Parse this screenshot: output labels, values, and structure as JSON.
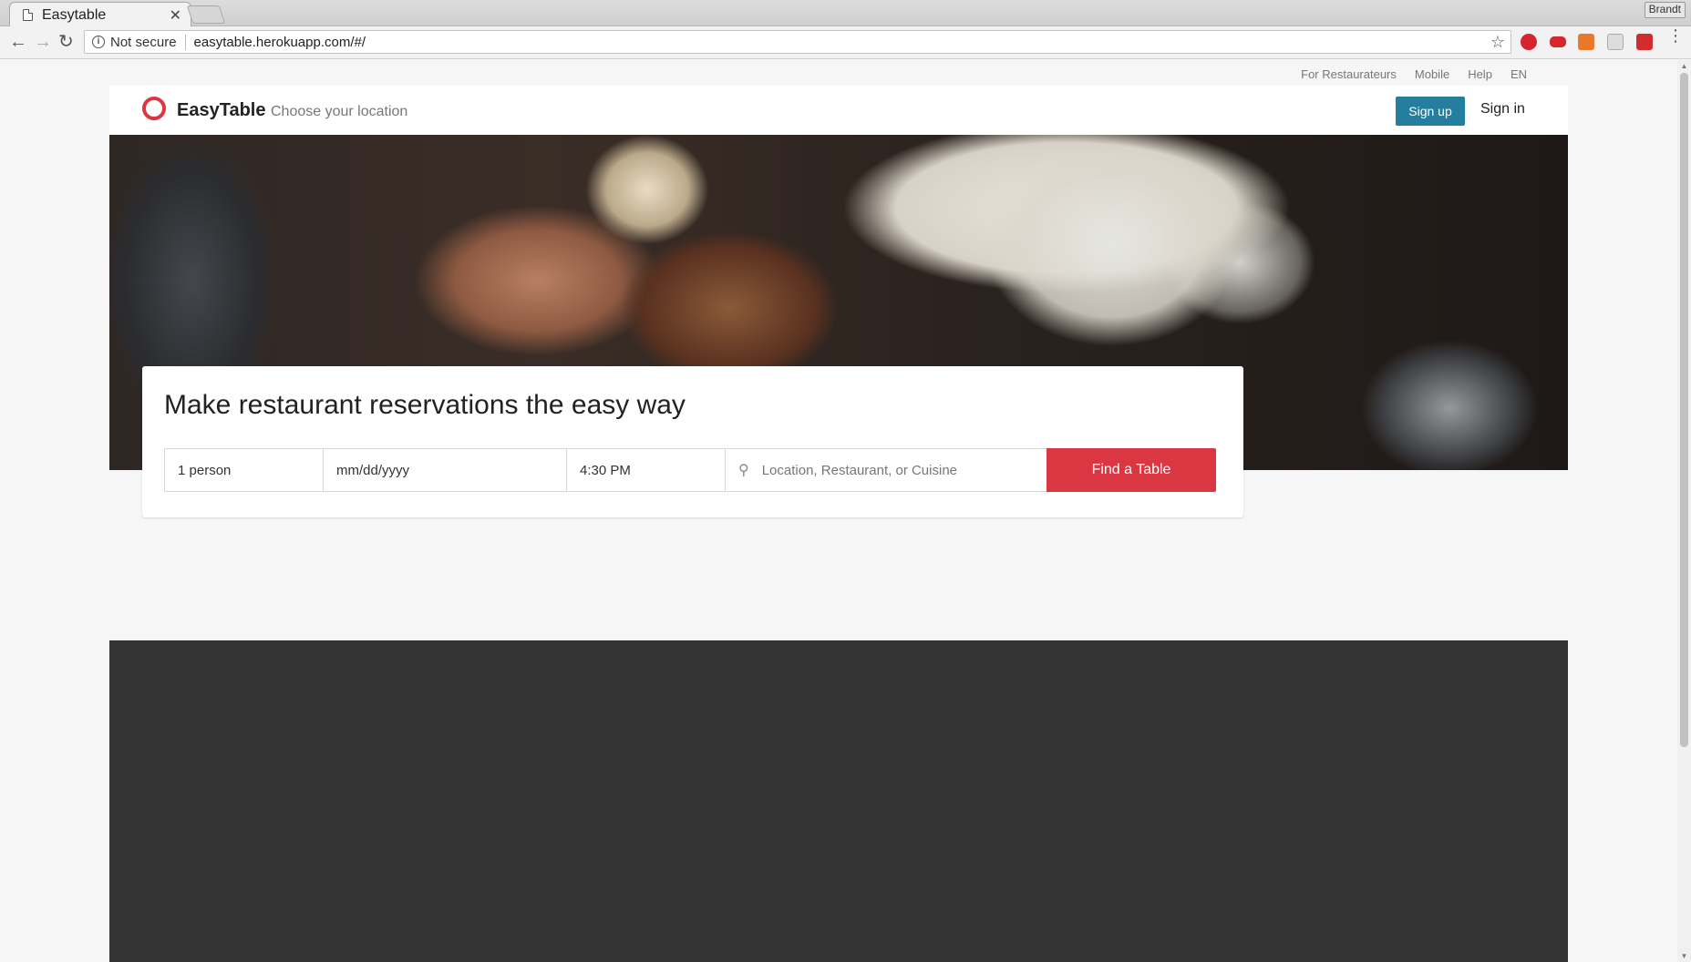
{
  "browser": {
    "tab_title": "Easytable",
    "profile_name": "Brandt",
    "security_label": "Not secure",
    "url": "easytable.herokuapp.com/#/"
  },
  "utility_nav": {
    "items": [
      "For Restaurateurs",
      "Mobile",
      "Help",
      "EN"
    ]
  },
  "header": {
    "brand": "EasyTable",
    "location_prompt": "Choose your location",
    "signup_label": "Sign up",
    "signin_label": "Sign in"
  },
  "search": {
    "headline": "Make restaurant reservations the easy way",
    "party_size": "1 person",
    "date_placeholder": "mm/dd/yyyy",
    "time": "4:30 PM",
    "query_placeholder": "Location, Restaurant, or Cuisine",
    "submit_label": "Find a Table"
  },
  "colors": {
    "brand_red": "#da3743",
    "signup_blue": "#247f9e",
    "footer_dark": "#333333"
  }
}
